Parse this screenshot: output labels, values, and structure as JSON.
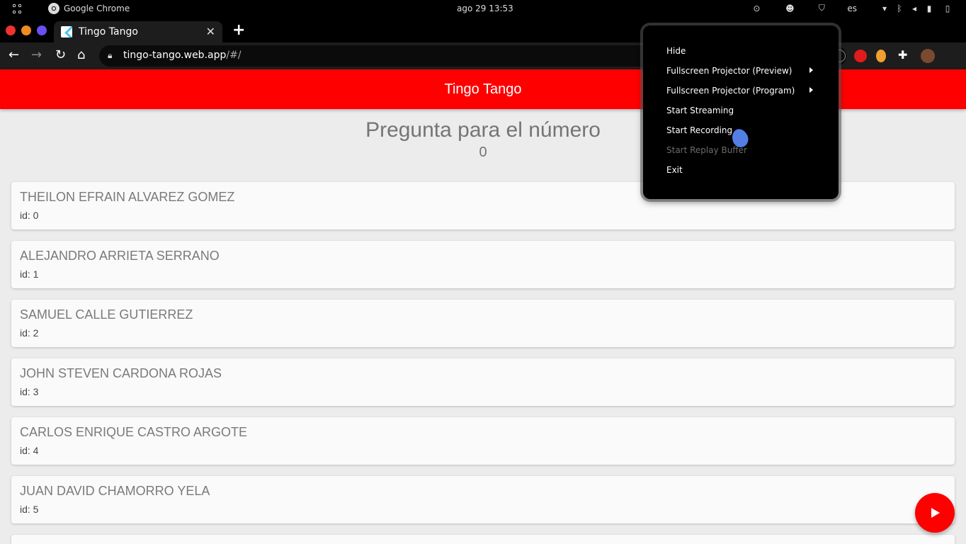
{
  "system_bar": {
    "app_name": "Google Chrome",
    "clock": "ago 29  13:53",
    "language": "es"
  },
  "browser": {
    "tab_title": "Tingo Tango",
    "tab_close": "✕",
    "new_tab": "+",
    "url_host": "tingo-tango.web.app",
    "url_path": "/#/"
  },
  "app": {
    "title": "Tingo Tango",
    "question": "Pregunta para el número",
    "number": "0"
  },
  "students": [
    {
      "name": "THEILON EFRAIN ALVAREZ GOMEZ",
      "id": "id: 0"
    },
    {
      "name": "ALEJANDRO ARRIETA SERRANO",
      "id": "id: 1"
    },
    {
      "name": "SAMUEL CALLE GUTIERREZ",
      "id": "id: 2"
    },
    {
      "name": "JOHN STEVEN CARDONA ROJAS",
      "id": "id: 3"
    },
    {
      "name": "CARLOS ENRIQUE CASTRO ARGOTE",
      "id": "id: 4"
    },
    {
      "name": "JUAN DAVID CHAMORRO YELA",
      "id": "id: 5"
    }
  ],
  "context_menu": {
    "items": [
      {
        "label": "Hide",
        "enabled": true,
        "submenu": false
      },
      {
        "label": "Fullscreen Projector (Preview)",
        "enabled": true,
        "submenu": true
      },
      {
        "label": "Fullscreen Projector (Program)",
        "enabled": true,
        "submenu": true
      },
      {
        "label": "Start Streaming",
        "enabled": true,
        "submenu": false
      },
      {
        "label": "Start Recording",
        "enabled": true,
        "submenu": false
      },
      {
        "label": "Start Replay Buffer",
        "enabled": false,
        "submenu": false
      },
      {
        "label": "Exit",
        "enabled": true,
        "submenu": false
      }
    ]
  },
  "colors": {
    "accent": "#ff0000",
    "background": "#ececec"
  }
}
